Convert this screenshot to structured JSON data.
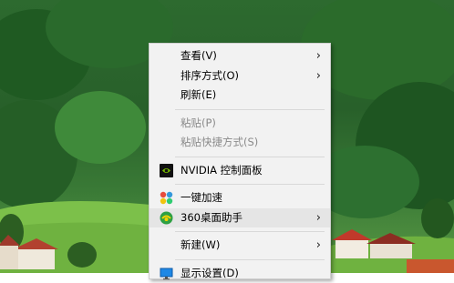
{
  "context_menu": {
    "view": "查看(V)",
    "sort_by": "排序方式(O)",
    "refresh": "刷新(E)",
    "paste": "粘贴(P)",
    "paste_shortcut": "粘贴快捷方式(S)",
    "nvidia": "NVIDIA 控制面板",
    "one_key_speedup": "一键加速",
    "desktop_helper": "360桌面助手",
    "new": "新建(W)",
    "display_settings": "显示设置(D)"
  },
  "submenu_arrow": "›",
  "icons": {
    "nvidia": "nvidia-icon",
    "speedup": "speedup-icon",
    "desktop_helper": "360-icon",
    "display": "display-icon"
  }
}
